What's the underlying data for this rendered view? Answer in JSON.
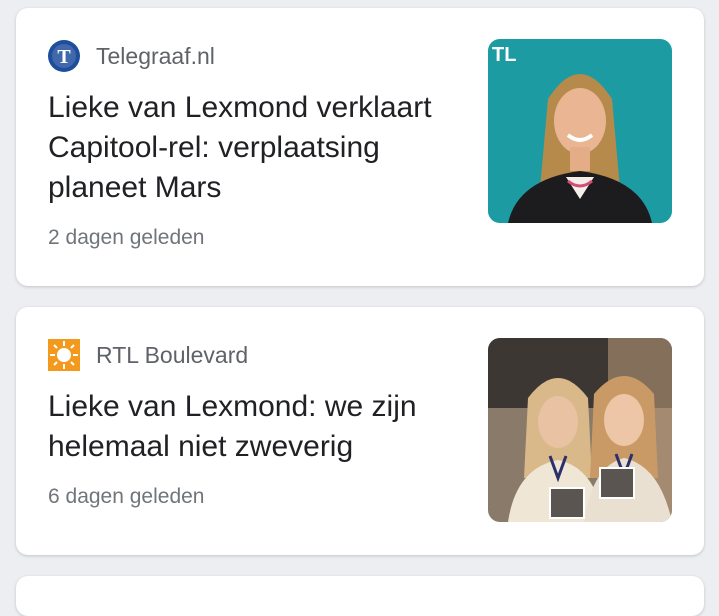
{
  "articles": [
    {
      "source": "Telegraaf.nl",
      "source_logo": "telegraaf-logo-icon",
      "title": "Lieke van Lexmond verklaart Capitool-rel: verplaatsing planeet Mars",
      "time": "2 dagen geleden",
      "thumbnail_badge": "TL"
    },
    {
      "source": "RTL Boulevard",
      "source_logo": "rtl-boulevard-logo-icon",
      "title": "Lieke van Lexmond: we zijn helemaal niet zweverig",
      "time": "6 dagen geleden"
    }
  ],
  "colors": {
    "background": "#eceef1",
    "card": "#ffffff",
    "title": "#202124",
    "meta": "#70757a",
    "telegraaf_blue": "#1f4e9c",
    "rtl_orange": "#f39a1e",
    "thumb1_bg": "#1fa3a6"
  }
}
